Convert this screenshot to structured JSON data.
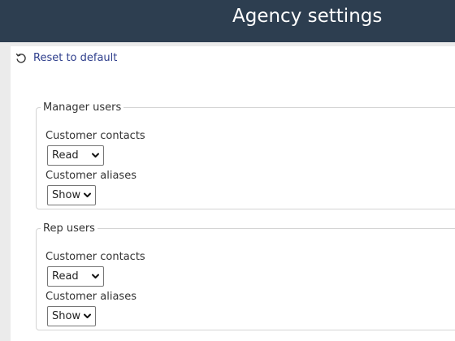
{
  "header": {
    "title": "Agency settings"
  },
  "toolbar": {
    "reset_label": "Reset to default"
  },
  "groups": [
    {
      "legend": "Manager users",
      "fields": [
        {
          "label": "Customer contacts",
          "value": "Read"
        },
        {
          "label": "Customer aliases",
          "value": "Show"
        }
      ]
    },
    {
      "legend": "Rep users",
      "fields": [
        {
          "label": "Customer contacts",
          "value": "Read"
        },
        {
          "label": "Customer aliases",
          "value": "Show"
        }
      ]
    }
  ],
  "colors": {
    "header_bg": "#2d3e50",
    "link": "#2e3e8c",
    "page_bg": "#ebebeb"
  },
  "icons": {
    "reset": "reset-icon",
    "dropdown": "chevron-down-icon"
  }
}
